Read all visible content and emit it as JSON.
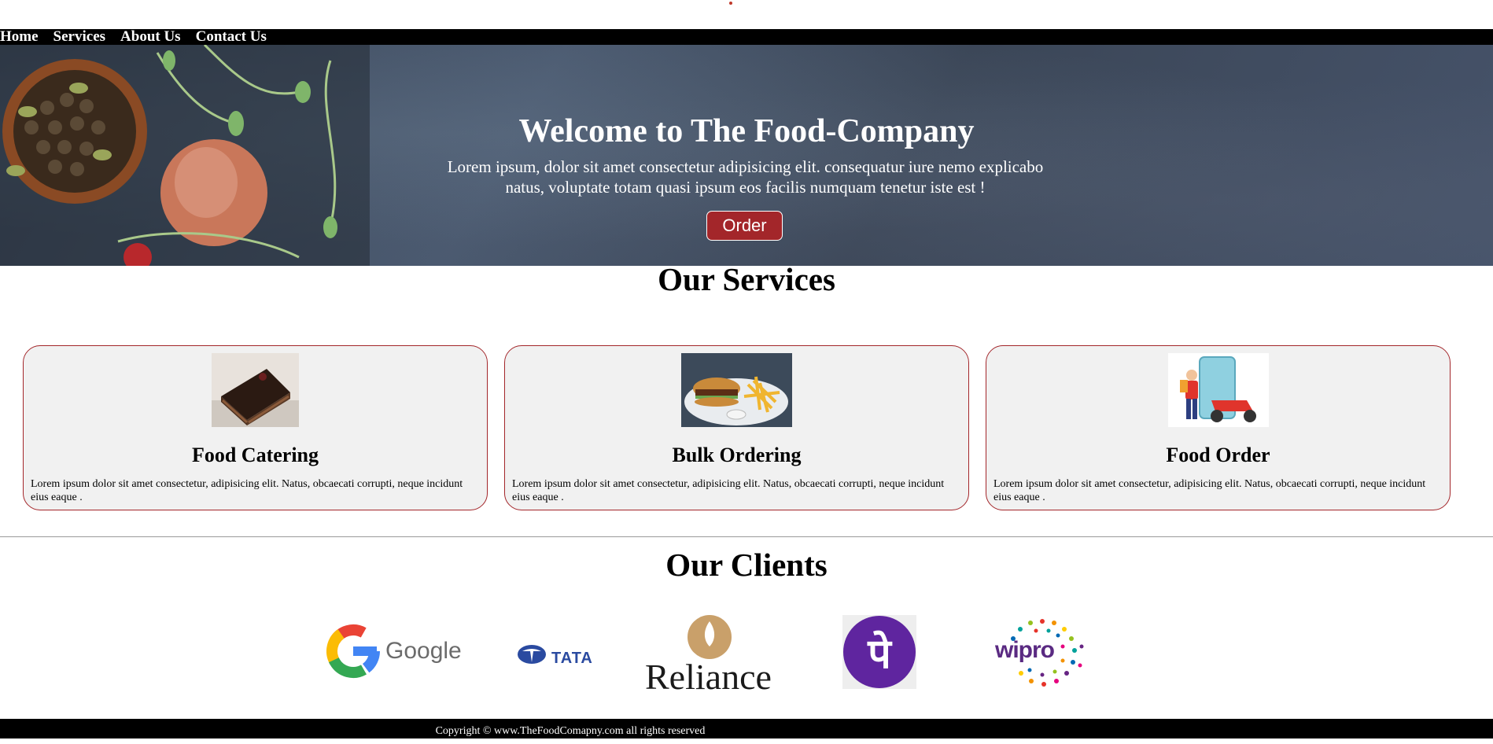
{
  "nav": {
    "items": [
      {
        "label": "Home"
      },
      {
        "label": "Services"
      },
      {
        "label": "About Us"
      },
      {
        "label": "Contact Us"
      }
    ]
  },
  "hero": {
    "title": "Welcome to The Food-Company",
    "text": "Lorem ipsum, dolor sit amet consectetur adipisicing elit. consequatur iure nemo explicabo natus, voluptate totam quasi ipsum eos facilis numquam tenetur iste est !",
    "button_label": "Order"
  },
  "services": {
    "title": "Our Services",
    "cards": [
      {
        "title": "Food Catering",
        "text": "Lorem ipsum dolor sit amet consectetur, adipisicing elit. Natus, obcaecati corrupti, neque incidunt eius eaque .",
        "image": "chocolate-cake-image"
      },
      {
        "title": "Bulk Ordering",
        "text": "Lorem ipsum dolor sit amet consectetur, adipisicing elit. Natus, obcaecati corrupti, neque incidunt eius eaque .",
        "image": "burger-fries-image"
      },
      {
        "title": "Food Order",
        "text": "Lorem ipsum dolor sit amet consectetur, adipisicing elit. Natus, obcaecati corrupti, neque incidunt eius eaque .",
        "image": "delivery-scooter-image"
      }
    ]
  },
  "clients": {
    "title": "Our Clients",
    "logos": [
      {
        "name": "Google"
      },
      {
        "name": "TATA"
      },
      {
        "name": "Reliance"
      },
      {
        "name": "PhonePe",
        "glyph": "पे"
      },
      {
        "name": "wipro"
      }
    ]
  },
  "footer": {
    "text": "Copyright © www.TheFoodComapny.com all rights reserved"
  },
  "colors": {
    "accent": "#a3262a",
    "nav_bg": "#000000",
    "card_bg": "#f1f1f1"
  }
}
